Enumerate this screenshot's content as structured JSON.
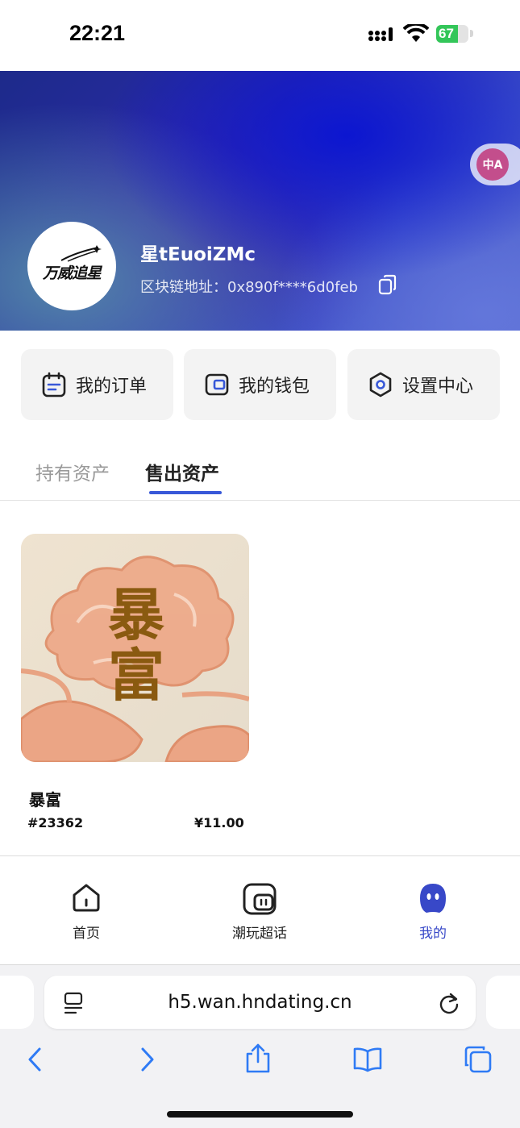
{
  "status_bar": {
    "time": "22:21",
    "battery_level": "67",
    "battery_fraction": 0.67
  },
  "profile": {
    "username": "星tEuoiZMc",
    "address_label": "区块链地址：",
    "address_value": "0x890f****6d0feb",
    "avatar_logo_text": "万威追星"
  },
  "translate": {
    "glyph": "中A"
  },
  "quick_actions": [
    {
      "label": "我的订单",
      "icon": "calendar-icon"
    },
    {
      "label": "我的钱包",
      "icon": "wallet-icon"
    },
    {
      "label": "设置中心",
      "icon": "settings-hex-icon"
    }
  ],
  "tabs": [
    {
      "label": "持有资产",
      "active": false
    },
    {
      "label": "售出资产",
      "active": true
    }
  ],
  "assets": [
    {
      "title": "暴富",
      "number": "#23362",
      "price": "¥11.00",
      "image_text": "暴富"
    }
  ],
  "bottom_nav": [
    {
      "label": "首页",
      "icon": "home-icon",
      "active": false
    },
    {
      "label": "潮玩超话",
      "icon": "chat-bubble-icon",
      "active": false
    },
    {
      "label": "我的",
      "icon": "profile-ghost-icon",
      "active": true
    }
  ],
  "browser": {
    "url": "h5.wan.hndating.cn"
  },
  "colors": {
    "accent": "#3858d8",
    "nav_active": "#3848c8",
    "battery": "#33c659"
  }
}
